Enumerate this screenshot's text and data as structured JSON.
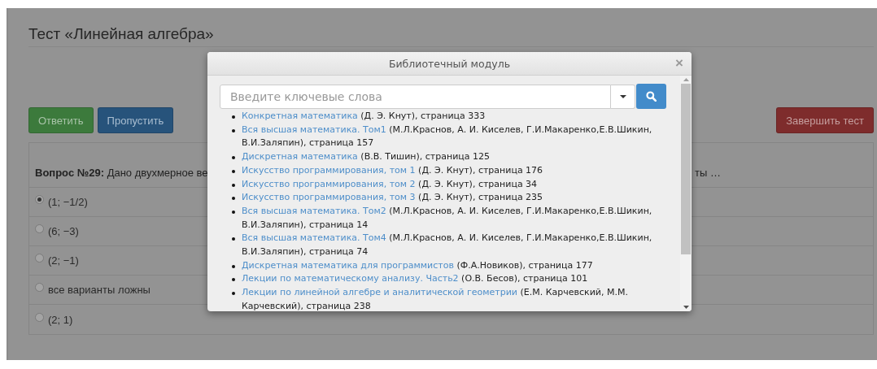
{
  "page": {
    "title": "Тест «Линейная алгебра»"
  },
  "actions": [
    {
      "label": "Ответить",
      "kind": "success"
    },
    {
      "label": "Пропустить",
      "kind": "primary"
    },
    {
      "label": "Завершить тест",
      "kind": "danger"
    }
  ],
  "question": {
    "label": "Вопрос №29:",
    "text_start": "Дано двухмерное ве",
    "text_end": "ты …"
  },
  "options": [
    {
      "label": "(1; −1/2)",
      "selected": true
    },
    {
      "label": "(6; −3)",
      "selected": false
    },
    {
      "label": "(2; −1)",
      "selected": false
    },
    {
      "label": "все варианты ложны",
      "selected": false
    },
    {
      "label": "(2; 1)",
      "selected": false
    }
  ],
  "modal": {
    "title": "Библиотечный модуль",
    "close": "×",
    "search": {
      "placeholder": "Введите ключевые слова"
    },
    "results": [
      {
        "title": "Конкретная математика",
        "details": "(Д. Э. Кнут), страница 333"
      },
      {
        "title": "Вся высшая математика. Том1",
        "details": "(М.Л.Краснов, А. И. Киселев, Г.И.Макаренко,Е.В.Шикин, В.И.Заляпин), страница 157"
      },
      {
        "title": "Дискретная математика",
        "details": "(В.В. Тишин), страница 125"
      },
      {
        "title": "Искусство программирования, том 1",
        "details": "(Д. Э. Кнут), страница 176"
      },
      {
        "title": "Искусство программирования, том 2",
        "details": "(Д. Э. Кнут), страница 34"
      },
      {
        "title": "Искусство программирования, том 3",
        "details": "(Д. Э. Кнут), страница 235"
      },
      {
        "title": "Вся высшая математика. Том2",
        "details": "(М.Л.Краснов, А. И. Киселев, Г.И.Макаренко,Е.В.Шикин, В.И.Заляпин), страница 14"
      },
      {
        "title": "Вся высшая математика. Том4",
        "details": "(М.Л.Краснов, А. И. Киселев, Г.И.Макаренко,Е.В.Шикин, В.И.Заляпин), страница 74"
      },
      {
        "title": "Дискретная математика для программистов",
        "details": "(Ф.А.Новиков), страница 177"
      },
      {
        "title": "Лекции по математическому анализу. Часть2",
        "details": "(О.В. Бесов), страница 101"
      },
      {
        "title": "Лекции по линейной алгебре и аналитической геометрии",
        "details": "(Е.М. Карчевский, М.М. Карчевский), страница 238"
      }
    ]
  }
}
